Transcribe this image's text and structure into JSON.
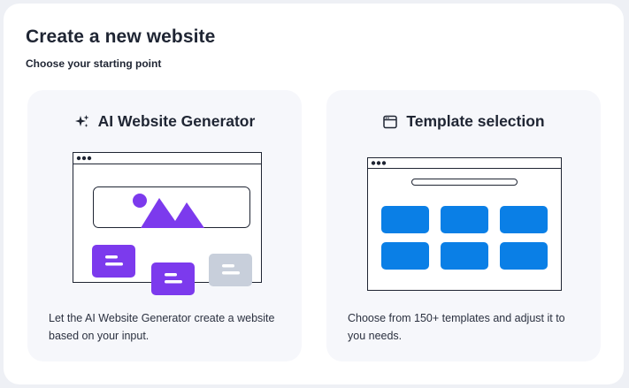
{
  "dialog": {
    "title": "Create a new website",
    "subtitle": "Choose your starting point"
  },
  "options": [
    {
      "id": "ai",
      "icon": "sparkles-icon",
      "title": "AI Website Generator",
      "description": "Let the AI Website Generator create a website based on your input."
    },
    {
      "id": "template",
      "icon": "browser-window-icon",
      "title": "Template selection",
      "description": "Choose from 150+ templates and adjust it to you needs."
    }
  ],
  "colors": {
    "ai_accent": "#7c3aed",
    "template_accent": "#0a7fe6",
    "muted_block": "#c8cfdb",
    "outline": "#1f2533",
    "card_background": "#f6f7fb"
  }
}
